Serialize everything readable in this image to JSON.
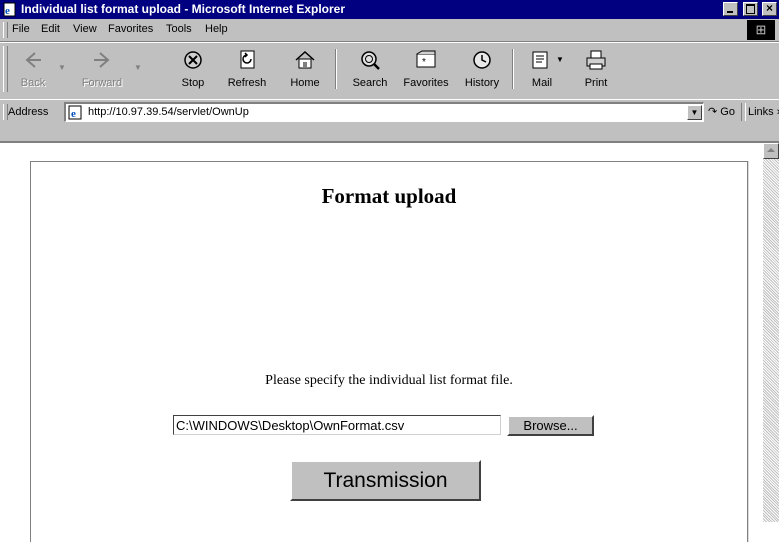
{
  "window": {
    "title": "Individual list format upload - Microsoft Internet Explorer",
    "icon": "ie-page-icon",
    "controls": [
      "minimize-icon",
      "maximize-icon",
      "close-icon"
    ]
  },
  "menu": {
    "items": [
      {
        "label": "File"
      },
      {
        "label": "Edit"
      },
      {
        "label": "View"
      },
      {
        "label": "Favorites"
      },
      {
        "label": "Tools"
      },
      {
        "label": "Help"
      }
    ]
  },
  "toolbar": {
    "buttons": [
      {
        "label": "Back",
        "icon": "back-arrow-icon",
        "enabled": false
      },
      {
        "label": "Forward",
        "icon": "forward-arrow-icon",
        "enabled": false
      },
      {
        "label": "Stop",
        "icon": "stop-icon",
        "enabled": true
      },
      {
        "label": "Refresh",
        "icon": "refresh-icon",
        "enabled": true
      },
      {
        "label": "Home",
        "icon": "home-icon",
        "enabled": true
      },
      {
        "label": "Search",
        "icon": "search-icon",
        "enabled": true
      },
      {
        "label": "Favorites",
        "icon": "favorites-icon",
        "enabled": true
      },
      {
        "label": "History",
        "icon": "history-icon",
        "enabled": true
      },
      {
        "label": "Mail",
        "icon": "mail-icon",
        "enabled": true
      },
      {
        "label": "Print",
        "icon": "print-icon",
        "enabled": true
      }
    ]
  },
  "address": {
    "label": "Address",
    "url": "http://10.97.39.54/servlet/OwnUp",
    "go_label": "Go",
    "links_label": "Links »"
  },
  "page": {
    "title": "Format upload",
    "instruction": "Please specify the individual list format file.",
    "file_value": "C:\\WINDOWS\\Desktop\\OwnFormat.csv",
    "browse_label": "Browse...",
    "submit_label": "Transmission"
  },
  "colors": {
    "titlebar": "#000080",
    "chrome": "#c0c0c0",
    "page_background": "#ffffff"
  }
}
